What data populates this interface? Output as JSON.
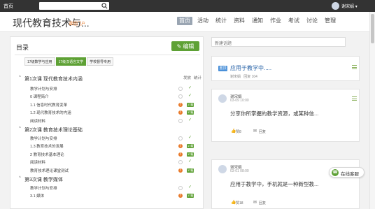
{
  "topbar": {
    "home": "首页",
    "search_placeholder": "",
    "user": "谢宋娟"
  },
  "header": {
    "course_title": "现代教育技术与...",
    "portal_link": "课程门户"
  },
  "nav": [
    "首页",
    "活动",
    "统计",
    "资料",
    "通知",
    "作业",
    "考试",
    "讨论",
    "管理"
  ],
  "nav_active": 0,
  "toc": {
    "title": "目录",
    "edit_label": "编辑",
    "tabs": [
      "17级数学与应用",
      "17级汉语言文学",
      "学校督导专用"
    ],
    "active_tab": 1,
    "col_publish": "发放",
    "col_stats": "统计",
    "rows": [
      {
        "kind": "chapter",
        "text": "第1次课 现代教育技术内涵"
      },
      {
        "kind": "section",
        "text": "教学计划与安排",
        "status": "empty",
        "check": true
      },
      {
        "kind": "section",
        "text": "0 课程简介",
        "status": "empty",
        "check": true
      },
      {
        "kind": "section",
        "text": "1.1 信息时代教育变革",
        "status": "orange",
        "badge": "17级"
      },
      {
        "kind": "section",
        "text": "1.2 现代教育技术的内涵",
        "status": "orange",
        "badge": "17级"
      },
      {
        "kind": "section",
        "text": "阅读材料",
        "status": "empty",
        "check": true
      },
      {
        "kind": "chapter",
        "text": "第2次课 教育技术理论基础"
      },
      {
        "kind": "section",
        "text": "教学计划与安排",
        "status": "empty",
        "check": true
      },
      {
        "kind": "section",
        "text": "1.3 教育技术的发展",
        "status": "orange",
        "badge": "17级"
      },
      {
        "kind": "section",
        "text": "2 教育技术基本理论",
        "status": "orange",
        "badge": "17级"
      },
      {
        "kind": "section",
        "text": "阅读材料",
        "status": "empty",
        "check": true
      },
      {
        "kind": "section",
        "text": "教育技术理论课堂测试",
        "status": "orange",
        "badge": "17级"
      },
      {
        "kind": "chapter",
        "text": "第3次课 教学媒体"
      },
      {
        "kind": "section",
        "text": "教学计划与安排",
        "status": "empty",
        "check": true
      },
      {
        "kind": "section",
        "text": "3.1 媒体",
        "status": "orange",
        "badge": "17级"
      }
    ]
  },
  "discussion": {
    "new_topic_placeholder": "新建话题",
    "pinned": {
      "badge": "置顶",
      "title": "应用于教学中.....",
      "author": "谢宋娟",
      "replies": "回复 104"
    },
    "posts": [
      {
        "author": "谢宋娟",
        "date": "03-09 10:00",
        "body": "分享你所掌握的教学资源，或某种信...",
        "likes": "赞8",
        "reply": "回复"
      },
      {
        "author": "谢宋娟",
        "date": "03-01 08:00",
        "body": "应用于教学中，手机就是一种新型教...",
        "likes": "赞18",
        "reply": "回复"
      }
    ]
  },
  "support": {
    "label": "在线客服"
  },
  "colors": {
    "green": "#5ea135",
    "orange": "#e97a2b",
    "blue": "#2a64a8",
    "topbar": "#333333"
  }
}
